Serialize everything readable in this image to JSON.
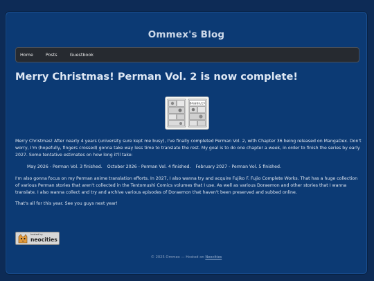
{
  "site": {
    "title": "Ommex's Blog"
  },
  "nav": {
    "items": [
      {
        "label": "Home"
      },
      {
        "label": "Posts"
      },
      {
        "label": "Guestbook"
      }
    ]
  },
  "post": {
    "title": "Merry Christmas! Perman Vol. 2 is now complete!",
    "image_caption": "あれはなんだ!!",
    "paragraph1": "Merry Christmas! After nearly 4 years (university sure kept me busy), I've finally completed Perman Vol. 2, with Chapter 36 being released on MangaDex. Don't worry, I'm (hopefully, fingers crossed) gonna take way less time to translate the rest. My goal is to do one chapter a week, in order to finish the series by early 2027. Some tentative estimates on how long it'll take:",
    "estimates": [
      "May 2026 - Perman Vol. 3 finished.",
      "October 2026 - Perman Vol. 4 finished.",
      "February 2027 - Perman Vol. 5 finished."
    ],
    "paragraph2": "I'm also gonna focus on my Perman anime translation efforts. In 2027, I also wanna try and acquire Fujiko F. Fujio Complete Works. That has a huge collection of various Perman stories that aren't collected in the Tentomushi Comics volumes that I use. As well as various Doraemon and other stories that I wanna translate. I also wanna collect and try and archive various episodes of Doraemon that haven't been preserved and subbed online.",
    "paragraph3": "That's all for this year. See you guys next year!"
  },
  "badge": {
    "small_text": "hosted by",
    "big_text": "neocities"
  },
  "footer": {
    "text": "© 2025 Ommex — Hosted on ",
    "link": "Neocities"
  },
  "colors": {
    "page_background": "#0d2b56",
    "panel_background": "#0c3a74",
    "navbar_background": "#262a30",
    "text": "#e3e9f2"
  }
}
